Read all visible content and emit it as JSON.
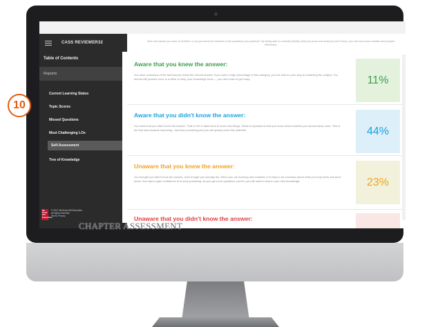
{
  "callout": {
    "number": "10"
  },
  "caption": "CHAPTER ASSESSMENT",
  "app": {
    "title": "CASS REVIEWER32",
    "menu_icon": "hamburger-icon"
  },
  "sidebar": {
    "toc_label": "Table of Contents",
    "reports_label": "Reports",
    "items": [
      {
        "label": "Current Learning Status",
        "active": false
      },
      {
        "label": "Topic Scores",
        "active": false
      },
      {
        "label": "Missed Questions",
        "active": false
      },
      {
        "label": "Most Challenging LOs",
        "active": false
      },
      {
        "label": "Self-Assessment",
        "active": true
      },
      {
        "label": "Tree of Knowledge",
        "active": false
      }
    ],
    "footer": {
      "logo_text": "Mc Graw Hill Education",
      "copyright": "© 2017 McGraw-Hill Education",
      "rights": "All rights reserved",
      "terms": "Terms",
      "privacy": "Privacy"
    }
  },
  "main": {
    "intro": "View how aware you were of whether or not you knew the answers to the questions you practiced. By being able to correctly identify what you know and what you don't know, you can focus your studies and prepare effectively.",
    "cards": [
      {
        "title": "Aware that you knew the answer:",
        "body": "You were conscious of the fact that you knew the correct answer. If you have a high percentage in this category, you are well on your way to mastering the subject. You should still practice once in a while to keep your knowledge fresh — you don't want to get rusty.",
        "percent": "11%",
        "title_color": "#3aa04b",
        "pct_color": "#3aa04b",
        "box_color": "#e4f1dd"
      },
      {
        "title": "Aware that you didn't know the answer:",
        "body": "You knew that you didn't know the answer. That is OK! It takes time to learn new things. What is important is that you know which material you should study more. This is the first step towards improving. Just keep practicing and you will quickly learn this material!",
        "percent": "44%",
        "title_color": "#1aa3dc",
        "pct_color": "#1aa3dc",
        "box_color": "#ddeff8"
      },
      {
        "title": "Unaware that you knew the answer:",
        "body": "You thought you didn't know the answer, even though you actually did. When you are learning new material, it is easy to be uncertain about what you truly know and don't know. One way to gain confidence is to keep practicing. As you get more questions correct, you will start to trust in your new knowledge!",
        "percent": "23%",
        "title_color": "#f0a21e",
        "pct_color": "#f0a21e",
        "box_color": "#f2f2dc"
      },
      {
        "title": "Unaware that you didn't know the answer:",
        "body": "",
        "percent": "",
        "title_color": "#e03b3b",
        "pct_color": "#e03b3b",
        "box_color": "#fbe6e6"
      }
    ]
  }
}
